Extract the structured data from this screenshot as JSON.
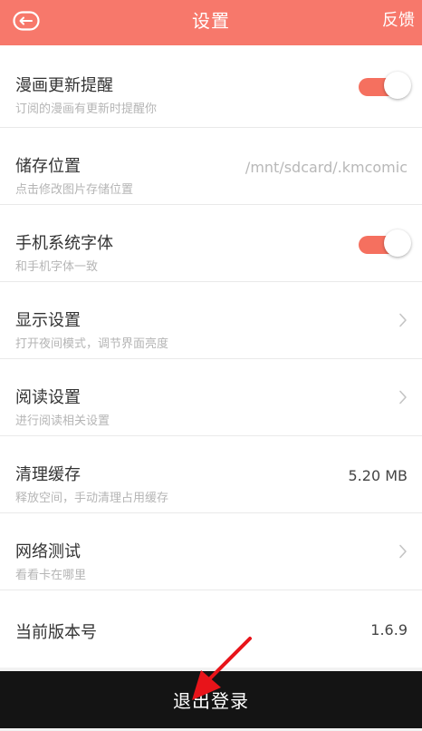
{
  "header": {
    "title": "设置",
    "feedback_label": "反馈",
    "back_icon": "back-arrow-icon",
    "background_color": "#f7786b"
  },
  "settings": [
    {
      "title": "漫画更新提醒",
      "subtitle": "订阅的漫画有更新时提醒你",
      "control": "toggle",
      "enabled": true
    },
    {
      "title": "储存位置",
      "subtitle": "点击修改图片存储位置",
      "control": "value",
      "value": "/mnt/sdcard/.kmcomic"
    },
    {
      "title": "手机系统字体",
      "subtitle": "和手机字体一致",
      "control": "toggle",
      "enabled": true
    },
    {
      "title": "显示设置",
      "subtitle": "打开夜间模式，调节界面亮度",
      "control": "chevron"
    },
    {
      "title": "阅读设置",
      "subtitle": "进行阅读相关设置",
      "control": "chevron"
    },
    {
      "title": "清理缓存",
      "subtitle": "释放空间，手动清理占用缓存",
      "control": "value",
      "value": "5.20 MB"
    },
    {
      "title": "网络测试",
      "subtitle": "看看卡在哪里",
      "control": "chevron"
    },
    {
      "title": "当前版本号",
      "control": "value",
      "value": "1.6.9"
    }
  ],
  "logout": {
    "label": "退出登录",
    "background_color": "#141414"
  },
  "annotation": {
    "icon": "red-arrow-pointer-icon",
    "color": "#e8141a"
  },
  "toggle_on_color": "#f5705f"
}
